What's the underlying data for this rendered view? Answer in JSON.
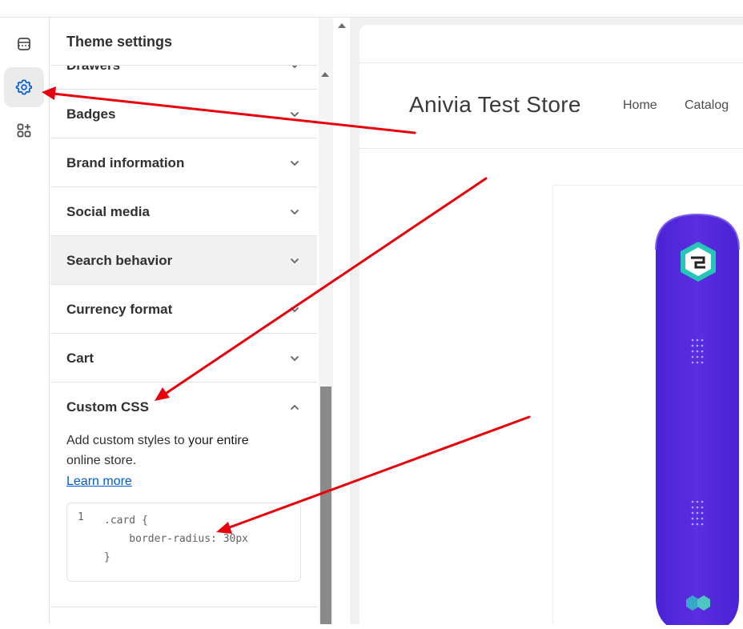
{
  "sidebar": {
    "rail": [
      {
        "name": "sections-icon"
      },
      {
        "name": "theme-settings-icon"
      },
      {
        "name": "apps-icon"
      }
    ],
    "panel_title": "Theme settings",
    "rows": [
      {
        "label": "Drawers"
      },
      {
        "label": "Badges"
      },
      {
        "label": "Brand information"
      },
      {
        "label": "Social media"
      },
      {
        "label": "Search behavior"
      },
      {
        "label": "Currency format"
      },
      {
        "label": "Cart"
      }
    ],
    "custom_css": {
      "label": "Custom CSS",
      "desc_plain": "Add custom styles to ",
      "desc_bold": "your entire",
      "desc_rest": "online store.",
      "learn_more": "Learn more",
      "line_number": "1",
      "code_line1": ".card {",
      "code_line2": "    border-radius: 30px",
      "code_line3": "}"
    }
  },
  "preview": {
    "store_name": "Anivia Test Store",
    "nav": [
      "Home",
      "Catalog"
    ]
  },
  "colors": {
    "accent": "#005bd3",
    "annotation_arrow": "#e8000b",
    "snowboard": "#5b2ee0"
  }
}
